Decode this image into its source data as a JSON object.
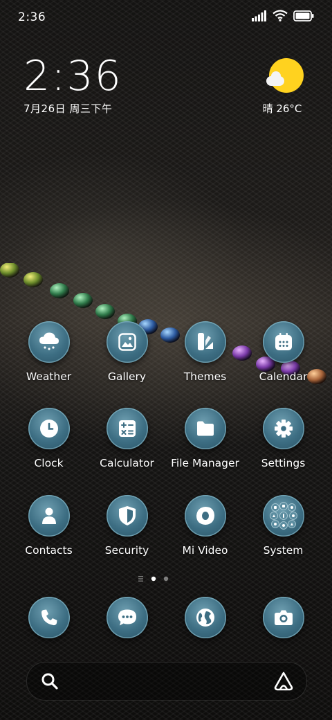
{
  "status_bar": {
    "time": "2:36"
  },
  "clock_widget": {
    "time": "2:36",
    "date": "7月26日 周三下午"
  },
  "weather_widget": {
    "text": "晴 26°C",
    "icon": "sun-cloud-icon"
  },
  "apps": [
    {
      "label": "Weather",
      "icon": "weather-cloud-icon"
    },
    {
      "label": "Gallery",
      "icon": "image-icon"
    },
    {
      "label": "Themes",
      "icon": "brush-icon"
    },
    {
      "label": "Calendar",
      "icon": "calendar-icon"
    },
    {
      "label": "Clock",
      "icon": "clock-icon"
    },
    {
      "label": "Calculator",
      "icon": "calculator-icon"
    },
    {
      "label": "File Manager",
      "icon": "folder-icon"
    },
    {
      "label": "Settings",
      "icon": "gear-icon"
    },
    {
      "label": "Contacts",
      "icon": "person-icon"
    },
    {
      "label": "Security",
      "icon": "shield-icon"
    },
    {
      "label": "Mi Video",
      "icon": "video-play-icon"
    },
    {
      "label": "System",
      "icon": "folder-grid-icon"
    }
  ],
  "dock": [
    {
      "icon": "phone-icon"
    },
    {
      "icon": "messages-icon"
    },
    {
      "icon": "browser-globe-icon"
    },
    {
      "icon": "camera-icon"
    }
  ],
  "page_indicator": {
    "current_page": 1,
    "pages": 2
  },
  "search_bar": {
    "search_icon": "search-icon",
    "assistant_icon": "assistant-icon"
  },
  "colors": {
    "icon_bg": "#3d6e83",
    "sun": "#ffd21f",
    "text": "#ffffff"
  }
}
